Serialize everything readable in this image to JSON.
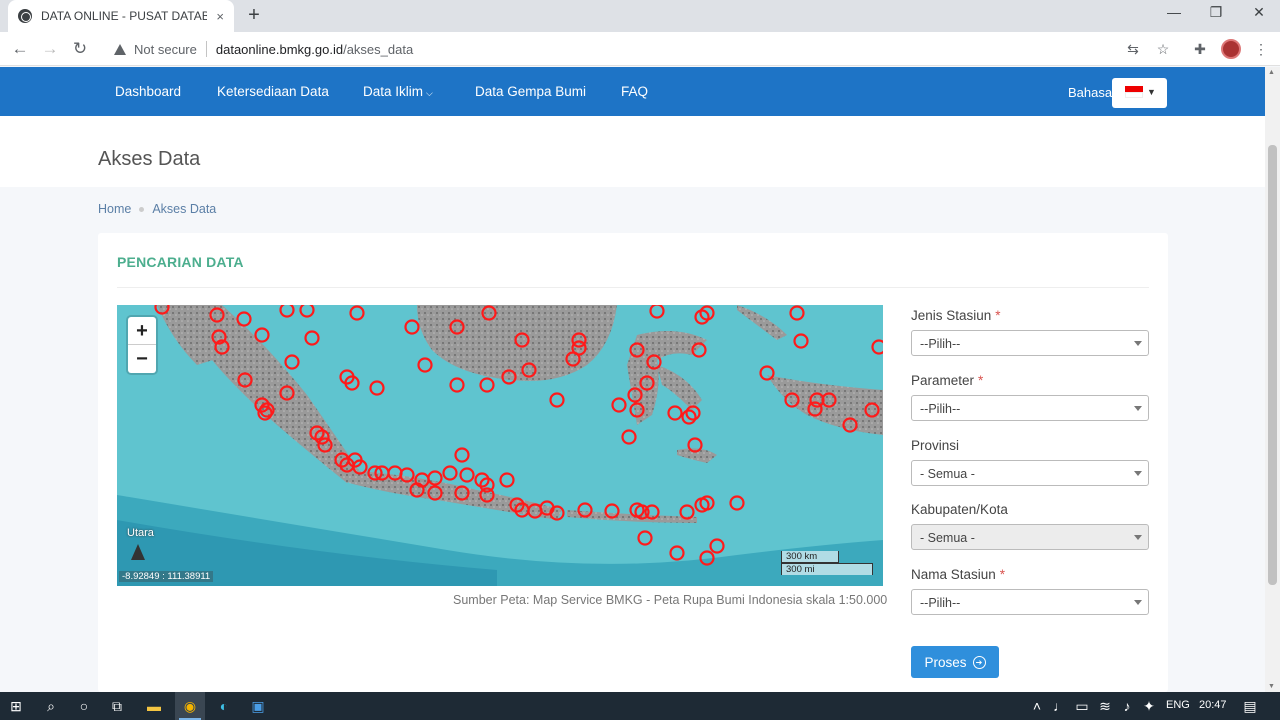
{
  "browser": {
    "tab_title": "DATA ONLINE - PUSAT DATABASE - BMKG",
    "tab_close": "×",
    "new_tab": "+",
    "not_secure": "Not secure",
    "url_domain": "dataonline.bmkg.go.id",
    "url_path": "/akses_data"
  },
  "nav": {
    "items": [
      "Dashboard",
      "Ketersediaan Data",
      "Data Iklim",
      "Data Gempa Bumi",
      "FAQ"
    ],
    "bahasa_label": "Bahasa:"
  },
  "page": {
    "title": "Akses Data",
    "breadcrumb": [
      "Home",
      "Akses Data"
    ],
    "card_title": "PENCARIAN DATA"
  },
  "map": {
    "zoom_in": "+",
    "zoom_out": "−",
    "north_label": "Utara",
    "coords": "-8.92849 : 111.38911",
    "scale_km": "300 km",
    "scale_mi": "300 mi",
    "source": "Sumber Peta: Map Service BMKG - Peta Rupa Bumi Indonesia skala 1:50.000",
    "marker_color": "#ff1a1a",
    "sea_color": "#5fc4cf"
  },
  "form": {
    "jenis_stasiun": {
      "label": "Jenis Stasiun",
      "value": "--Pilih--"
    },
    "parameter": {
      "label": "Parameter",
      "value": "--Pilih--"
    },
    "provinsi": {
      "label": "Provinsi",
      "value": "- Semua -"
    },
    "kabupaten": {
      "label": "Kabupaten/Kota",
      "value": "- Semua -"
    },
    "nama_stasiun": {
      "label": "Nama Stasiun",
      "value": "--Pilih--"
    },
    "required_mark": "*",
    "submit": "Proses"
  },
  "taskbar": {
    "language": "ENG",
    "time": "20:47"
  },
  "colors": {
    "navbar": "#1e74c6",
    "title_accent": "#4cae8e",
    "button": "#2f8fdc"
  }
}
